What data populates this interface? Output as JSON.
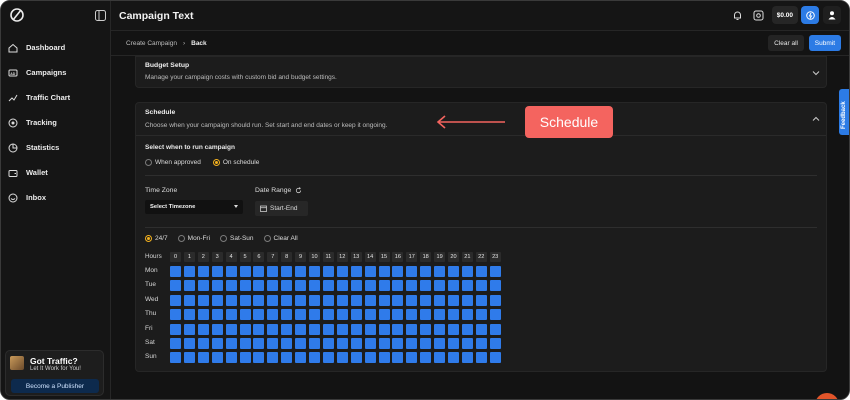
{
  "header": {
    "title": "Campaign Text",
    "balance": "$0.00"
  },
  "sidebar": {
    "items": [
      {
        "label": "Dashboard",
        "icon": "home-icon"
      },
      {
        "label": "Campaigns",
        "icon": "ad-icon"
      },
      {
        "label": "Traffic Chart",
        "icon": "traffic-icon"
      },
      {
        "label": "Tracking",
        "icon": "target-icon"
      },
      {
        "label": "Statistics",
        "icon": "pie-chart-icon"
      },
      {
        "label": "Wallet",
        "icon": "wallet-icon"
      },
      {
        "label": "Inbox",
        "icon": "inbox-icon"
      }
    ],
    "promo": {
      "title": "Got Traffic?",
      "subtitle": "Let It Work for You!",
      "button": "Become a Publisher"
    }
  },
  "subheader": {
    "crumb": "Create Campaign",
    "back": "Back",
    "clear_all": "Clear all",
    "submit": "Submit"
  },
  "budget": {
    "title": "Budget Setup",
    "subtitle": "Manage your campaign costs with custom bid and budget settings."
  },
  "schedule": {
    "title": "Schedule",
    "subtitle": "Choose when your campaign should run. Set start and end dates or keep it ongoing.",
    "select_label": "Select when to run campaign",
    "options": [
      "When approved",
      "On schedule"
    ],
    "selected_option": "On schedule",
    "timezone_label": "Time Zone",
    "timezone_value": "Select Timezone",
    "date_range_label": "Date Range",
    "date_range_value": "Start-End",
    "presets": [
      "24/7",
      "Mon-Fri",
      "Sat-Sun",
      "Clear All"
    ],
    "selected_preset": "24/7",
    "hours_label": "Hours",
    "hours": [
      "0",
      "1",
      "2",
      "3",
      "4",
      "5",
      "6",
      "7",
      "8",
      "9",
      "10",
      "11",
      "12",
      "13",
      "14",
      "15",
      "16",
      "17",
      "18",
      "19",
      "20",
      "21",
      "22",
      "23"
    ],
    "days": [
      "Mon",
      "Tue",
      "Wed",
      "Thu",
      "Fri",
      "Sat",
      "Sun"
    ],
    "all_selected": true
  },
  "annotation": {
    "label": "Schedule"
  },
  "feedback": "Feedback",
  "colors": {
    "accent": "#2c7be5",
    "grid_cell": "#2f7bea",
    "radio_selected": "#f2b01e",
    "callout": "#f4645f"
  }
}
